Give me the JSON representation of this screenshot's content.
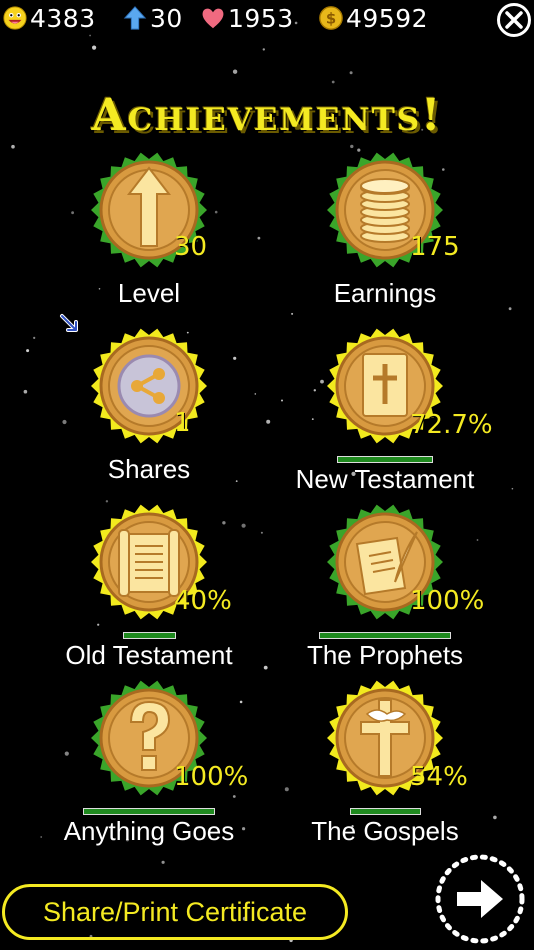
{
  "stats": {
    "smiles": "4383",
    "level": "30",
    "hearts": "1953",
    "coins": "49592"
  },
  "title": "Achievements!",
  "badges": [
    {
      "label": "Level",
      "value": "30",
      "icon": "arrow-up-icon",
      "rim": "green",
      "progress": null
    },
    {
      "label": "Earnings",
      "value": "175",
      "icon": "coin-stack-icon",
      "rim": "green",
      "progress": null
    },
    {
      "label": "Shares",
      "value": "1",
      "icon": "share-icon",
      "rim": "yellow",
      "progress": null
    },
    {
      "label": "New Testament",
      "value": "72.7%",
      "icon": "bible-icon",
      "rim": "yellow",
      "progress": 0.727
    },
    {
      "label": "Old Testament",
      "value": "40%",
      "icon": "scroll-icon",
      "rim": "yellow",
      "progress": 0.4
    },
    {
      "label": "The Prophets",
      "value": "100%",
      "icon": "quill-parchment-icon",
      "rim": "green",
      "progress": 1.0
    },
    {
      "label": "Anything Goes",
      "value": "100%",
      "icon": "question-mark-icon",
      "rim": "green",
      "progress": 1.0
    },
    {
      "label": "The Gospels",
      "value": "54%",
      "icon": "cross-dove-icon",
      "rim": "yellow",
      "progress": 0.54
    }
  ],
  "certificate_button": "Share/Print Certificate",
  "colors": {
    "title": "#f4ea22",
    "rim_green": "#3aa52a",
    "rim_yellow": "#f2ea1e",
    "medal_gold": "#d89a40",
    "progress": "#1f8a1f"
  }
}
